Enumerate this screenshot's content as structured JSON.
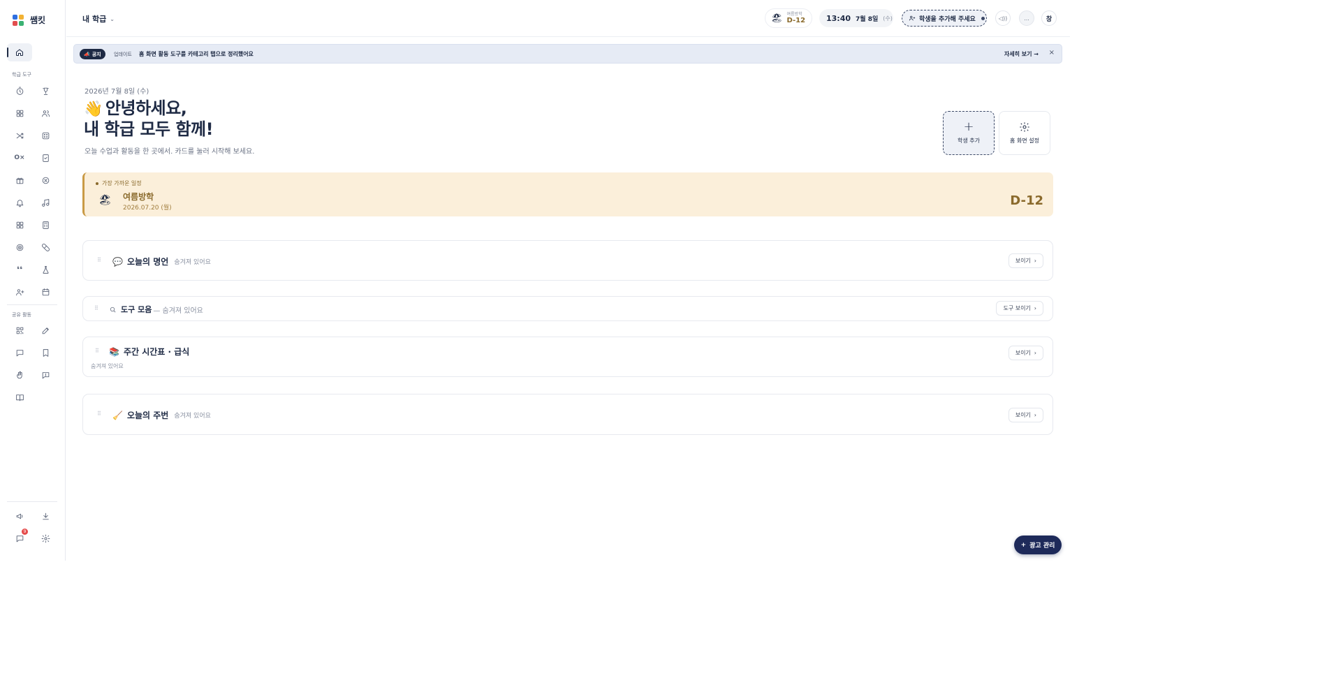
{
  "app": {
    "name": "쌤킷"
  },
  "sidebar": {
    "section_tools": "학급 도구",
    "section_activity": "공유 활동",
    "notification_count": "9",
    "icons": {
      "home": "home-icon",
      "timer": "timer-icon",
      "trophy": "trophy-icon",
      "grid": "grid-icon",
      "group": "group-icon",
      "shuffle": "shuffle-icon",
      "dice": "dice-icon",
      "ox": "ox-icon",
      "checklist": "checklist-icon",
      "gift": "gift-icon",
      "cancel": "circle-x-icon",
      "bell": "bell-icon",
      "music": "music-icon",
      "apps": "apps-icon",
      "calc": "calculator-icon",
      "target": "target-icon",
      "pill": "pill-icon",
      "quote": "quote-icon",
      "flask": "flask-icon",
      "user_plus": "user-plus-icon",
      "calendar": "calendar-icon",
      "qr": "qr-icon",
      "edit": "edit-icon",
      "chat": "chat-icon",
      "bookmark": "bookmark-icon",
      "hand": "hand-icon",
      "message": "message-icon",
      "book": "book-icon",
      "megaphone": "megaphone-icon",
      "download": "download-icon",
      "feedback": "feedback-icon",
      "settings": "gear-icon"
    }
  },
  "topbar": {
    "class_name": "내 학급",
    "dday_small": "여름방학",
    "dday_value": "D-12",
    "time": "13:40",
    "date": "7월 8일",
    "dow": "(수)",
    "add_student_prompt": "학생을 추가해 주세요",
    "more_label": "...",
    "window_label": "창"
  },
  "notice": {
    "tag": "공지",
    "kind": "업데이트",
    "message": "홈 화면 활동 도구를 카테고리 탭으로 정리했어요",
    "more": "자세히 보기 →",
    "close": "×"
  },
  "greeting": {
    "date": "2026년 7월 8일 (수)",
    "wave": "👋",
    "line1": "안녕하세요,",
    "line2": "내 학급 모두 함께!",
    "subtitle": "오늘 수업과 활동을 한 곳에서. 카드를 눌러 시작해 보세요."
  },
  "actions": {
    "add_student": "학생 추가",
    "home_settings": "홈 화면 설정"
  },
  "event": {
    "label": "가장 가까운 일정",
    "emoji": "🏖",
    "name": "여름방학",
    "date": "2026.07.20 (월)",
    "dday": "D-12"
  },
  "widgets": {
    "quote": {
      "icon": "💬",
      "title": "오늘의 명언",
      "hidden": "숨겨져 있어요",
      "button": "보이기"
    },
    "tools": {
      "title": "도구 모음",
      "hidden": "— 숨겨져 있어요",
      "button": "도구 보이기"
    },
    "timetable": {
      "icon": "📚",
      "title": "주간 시간표 · 급식",
      "hidden": "숨겨져 있어요",
      "button": "보이기"
    },
    "duty": {
      "icon": "🧹",
      "title": "오늘의 주번",
      "hidden": "숨겨져 있어요",
      "button": "보이기"
    }
  },
  "fab": {
    "label": "광고 관리"
  },
  "colors": {
    "navy": "#1e2a44",
    "accent_gold": "#8a6a2c",
    "event_bg": "#fbefda",
    "notice_bg": "#e6ebf5"
  }
}
